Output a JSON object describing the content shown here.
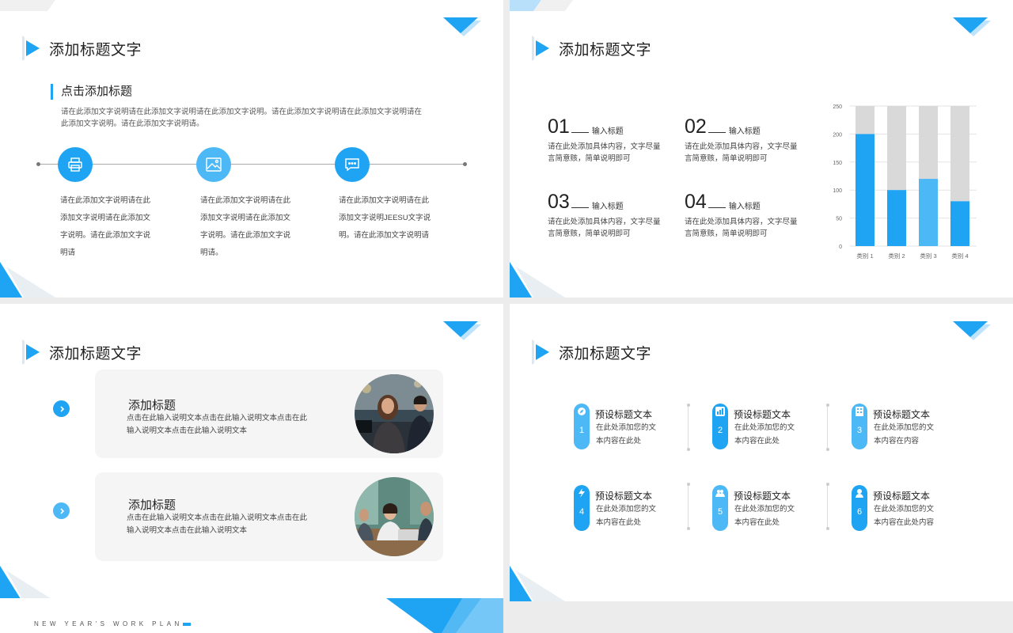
{
  "slides": {
    "s1": {
      "title": "添加标题文字",
      "subtitle": "点击添加标题",
      "description": "请在此添加文字说明请在此添加文字说明请在此添加文字说明。请在此添加文字说明请在此添加文字说明请在此添加文字说明。请在此添加文字说明请。",
      "columns": [
        {
          "icon": "printer-icon",
          "text": "请在此添加文字说明请在此添加文字说明请在此添加文字说明。请在此添加文字说明请"
        },
        {
          "icon": "image-icon",
          "text": "请在此添加文字说明请在此添加文字说明请在此添加文字说明。请在此添加文字说明请。"
        },
        {
          "icon": "chat-icon",
          "text": "请在此添加文字说明请在此添加文字说明JEESU文字说明。请在此添加文字说明请"
        }
      ]
    },
    "s2": {
      "title": "添加标题文字",
      "items": [
        {
          "num": "01",
          "label": "输入标题",
          "body": "请在此处添加具体内容，文字尽量言简意赅，简单说明即可"
        },
        {
          "num": "02",
          "label": "输入标题",
          "body": "请在此处添加具体内容，文字尽量言简意赅，简单说明即可"
        },
        {
          "num": "03",
          "label": "输入标题",
          "body": "请在此处添加具体内容，文字尽量言简意赅，简单说明即可"
        },
        {
          "num": "04",
          "label": "输入标题",
          "body": "请在此处添加具体内容，文字尽量言简意赅，简单说明即可"
        }
      ]
    },
    "s3": {
      "title": "添加标题文字",
      "cards": [
        {
          "title": "添加标题",
          "text": "点击在此输入说明文本点击在此输入说明文本点击在此输入说明文本点击在此输入说明文本"
        },
        {
          "title": "添加标题",
          "text": "点击在此输入说明文本点击在此输入说明文本点击在此输入说明文本点击在此输入说明文本"
        }
      ]
    },
    "s4": {
      "title": "添加标题文字",
      "items": [
        {
          "num": "1",
          "icon": "compass-icon",
          "title": "预设标题文本",
          "text": "在此处添加您的文本内容在此处",
          "color": "#4db8f6"
        },
        {
          "num": "2",
          "icon": "chart-icon",
          "title": "预设标题文本",
          "text": "在此处添加您的文本内容在此处",
          "color": "#1ea4f3"
        },
        {
          "num": "3",
          "icon": "building-icon",
          "title": "预设标题文本",
          "text": "在此处添加您的文本内容在内容",
          "color": "#4db8f6"
        },
        {
          "num": "4",
          "icon": "bolt-icon",
          "title": "预设标题文本",
          "text": "在此处添加您的文本内容在此处",
          "color": "#1ea4f3"
        },
        {
          "num": "5",
          "icon": "people-icon",
          "title": "预设标题文本",
          "text": "在此处添加您的文本内容在此处",
          "color": "#4db8f6"
        },
        {
          "num": "6",
          "icon": "user-icon",
          "title": "预设标题文本",
          "text": "在此处添加您的文本内容在此处内容",
          "color": "#1ea4f3"
        }
      ]
    },
    "s5": {
      "text": "NEW YEAR'S WORK PLAN"
    }
  },
  "colors": {
    "accent": "#1ea4f3",
    "accent_light": "#4db8f6",
    "bar_bg": "#d9d9d9",
    "card_bg": "#f5f5f5"
  },
  "chart_data": {
    "type": "bar",
    "stacked": true,
    "categories": [
      "类别 1",
      "类别 2",
      "类别 3",
      "类别 4"
    ],
    "series": [
      {
        "values": [
          200,
          100,
          120,
          80
        ]
      },
      {
        "values": [
          50,
          150,
          130,
          170
        ]
      }
    ],
    "ylim": [
      0,
      250
    ],
    "yticks": [
      0,
      50,
      100,
      150,
      200,
      250
    ],
    "grid": true
  }
}
